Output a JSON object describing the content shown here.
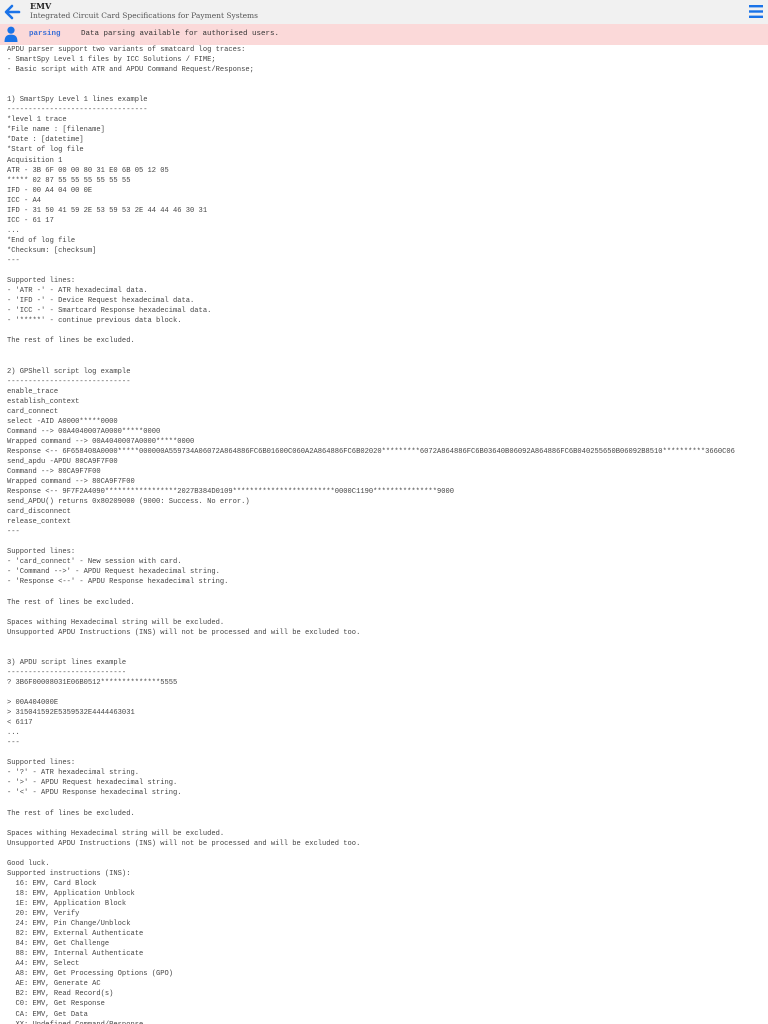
{
  "header": {
    "app_name": "EMV",
    "subtitle": "Integrated Circuit Card Specifications for Payment Systems"
  },
  "notice": {
    "badge": "parsing",
    "message": "Data parsing available for authorised users."
  },
  "icons": {
    "back": "arrow-left-icon",
    "menu": "hamburger-menu-icon",
    "user": "user-icon"
  },
  "colors": {
    "accent": "#1a73e8",
    "notice_bg": "#fbd9d9",
    "badge_text": "#3b6fd6"
  },
  "content": {
    "text": "APDU parser support two variants of smatcard log traces:\n- SmartSpy Level 1 files by ICC Solutions / FIME;\n- Basic script with ATR and APDU Command Request/Response;\n\n\n1) SmartSpy Level 1 lines example\n---------------------------------\n*level 1 trace\n*File name : [filename]\n*Date : [datetime]\n*Start of log file\nAcquisition 1\nATR - 3B 6F 00 00 80 31 E0 6B 05 12 05\n***** 02 87 55 55 55 55 55 55\nIFD - 00 A4 04 00 0E\nICC - A4\nIFD - 31 50 41 59 2E 53 59 53 2E 44 44 46 30 31\nICC - 61 17\n...\n*End of log file\n*Checksum: [checksum]\n---\n\nSupported lines:\n- 'ATR -' - ATR hexadecimal data.\n- 'IFD -' - Device Request hexadecimal data.\n- 'ICC -' - Smartcard Response hexadecimal data.\n- '*****' - continue previous data block.\n\nThe rest of lines be excluded.\n\n\n2) GPShell script log example\n-----------------------------\nenable_trace\nestablish_context\ncard_connect\nselect -AID A0000*****0000\nCommand --> 00A4040007A0000*****0000\nWrapped command --> 00A4040007A0000*****0000\nResponse <-- 6F658408A0000*****000000A559734A06072A864886FC6B01600C060A2A864886FC6B02020*********6072A864886FC6B03640B06092A864886FC6B040255650B06092B8510**********3660C06\nsend_apdu -APDU 80CA9F7F00\nCommand --> 80CA9F7F00\nWrapped command --> 80CA9F7F00\nResponse <-- 9F7F2A4090*****************2027B384D0109************************0000C1190***************9000\nsend_APDU() returns 0x80209000 (9000: Success. No error.)\ncard_disconnect\nrelease_context\n---\n\nSupported lines:\n- 'card_connect' - New session with card.\n- 'Command -->' - APDU Request hexadecimal string.\n- 'Response <--' - APDU Response hexadecimal string.\n\nThe rest of lines be excluded.\n\nSpaces withing Hexadecimal string will be excluded.\nUnsupported APDU Instructions (INS) will not be processed and will be excluded too.\n\n\n3) APDU script lines example\n----------------------------\n? 3B6F00008031E06B0512**************5555\n\n> 00A404000E\n> 315041592E5359532E4444463031\n< 6117\n...\n---\n\nSupported lines:\n- '?' - ATR hexadecimal string.\n- '>' - APDU Request hexadecimal string.\n- '<' - APDU Response hexadecimal string.\n\nThe rest of lines be excluded.\n\nSpaces withing Hexadecimal string will be excluded.\nUnsupported APDU Instructions (INS) will not be processed and will be excluded too.\n\nGood luck.\nSupported instructions (INS):\n  16: EMV, Card Block\n  18: EMV, Application Unblock\n  1E: EMV, Application Block\n  20: EMV, Verify\n  24: EMV, Pin Change/Unblock\n  82: EMV, External Authenticate\n  84: EMV, Get Challenge\n  88: EMV, Internal Authenticate\n  A4: EMV, Select\n  A8: EMV, Get Processing Options (GPO)\n  AE: EMV, Generate AC\n  B2: EMV, Read Record(s)\n  C0: EMV, Get Response\n  CA: EMV, Get Data\n  XX: Undefined Command/Response"
  }
}
